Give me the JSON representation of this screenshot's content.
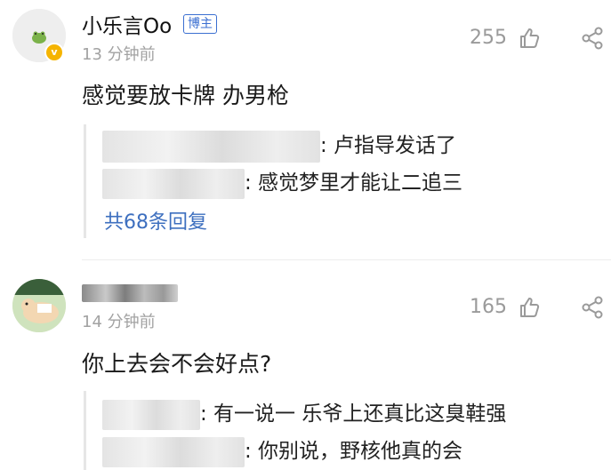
{
  "comments": [
    {
      "username": "小乐言Oo",
      "author_tag": "博主",
      "verified_mark": "v",
      "time": "13 分钟前",
      "likes": "255",
      "text": "感觉要放卡牌 办男枪",
      "replies": [
        {
          "text": ": 卢指导发话了"
        },
        {
          "text": ": 感觉梦里才能让二追三"
        }
      ],
      "more_replies": "共68条回复"
    },
    {
      "username": "",
      "time": "14 分钟前",
      "likes": "165",
      "text": "你上去会不会好点?",
      "replies": [
        {
          "text": ": 有一说一 乐爷上还真比这臭鞋强"
        },
        {
          "text": ": 你别说，野核他真的会"
        }
      ]
    }
  ],
  "icons": {
    "like": "thumbs-up-icon",
    "share": "share-icon"
  },
  "colors": {
    "link_blue": "#3d6fbf",
    "meta_gray": "#a2a2a2",
    "verified_gold": "#f5b400"
  }
}
